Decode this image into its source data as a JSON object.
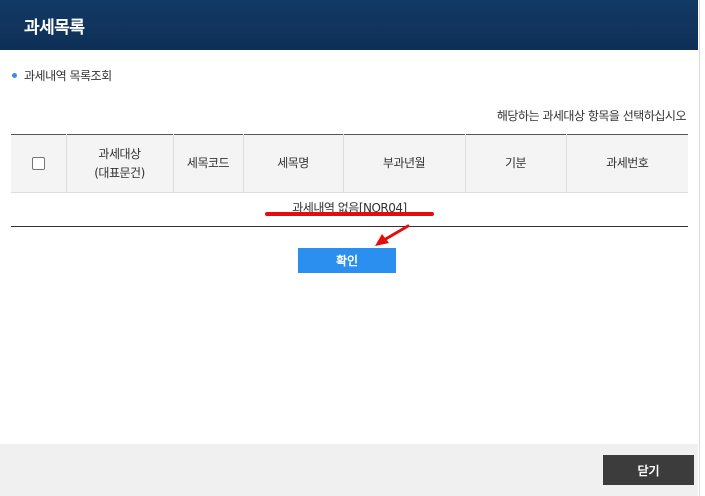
{
  "header": {
    "title": "과세목록"
  },
  "section": {
    "subtitle": "과세내역 목록조회"
  },
  "instruction": "해당하는 과세대상 항목을 선택하십시오",
  "table": {
    "columns": [
      {
        "line1": "과세대상",
        "line2": "(대표문건)"
      },
      {
        "line1": "세목코드",
        "line2": ""
      },
      {
        "line1": "세목명",
        "line2": ""
      },
      {
        "line1": "부과년월",
        "line2": ""
      },
      {
        "line1": "기분",
        "line2": ""
      },
      {
        "line1": "과세번호",
        "line2": ""
      }
    ],
    "empty_message": "과세내역 없음[NOR04]"
  },
  "buttons": {
    "confirm": "확인",
    "close": "닫기"
  },
  "colors": {
    "header_bg": "#123a66",
    "confirm_bg": "#2b8ff0",
    "close_bg": "#3c3c3c",
    "annotation_red": "#e30d0d"
  }
}
